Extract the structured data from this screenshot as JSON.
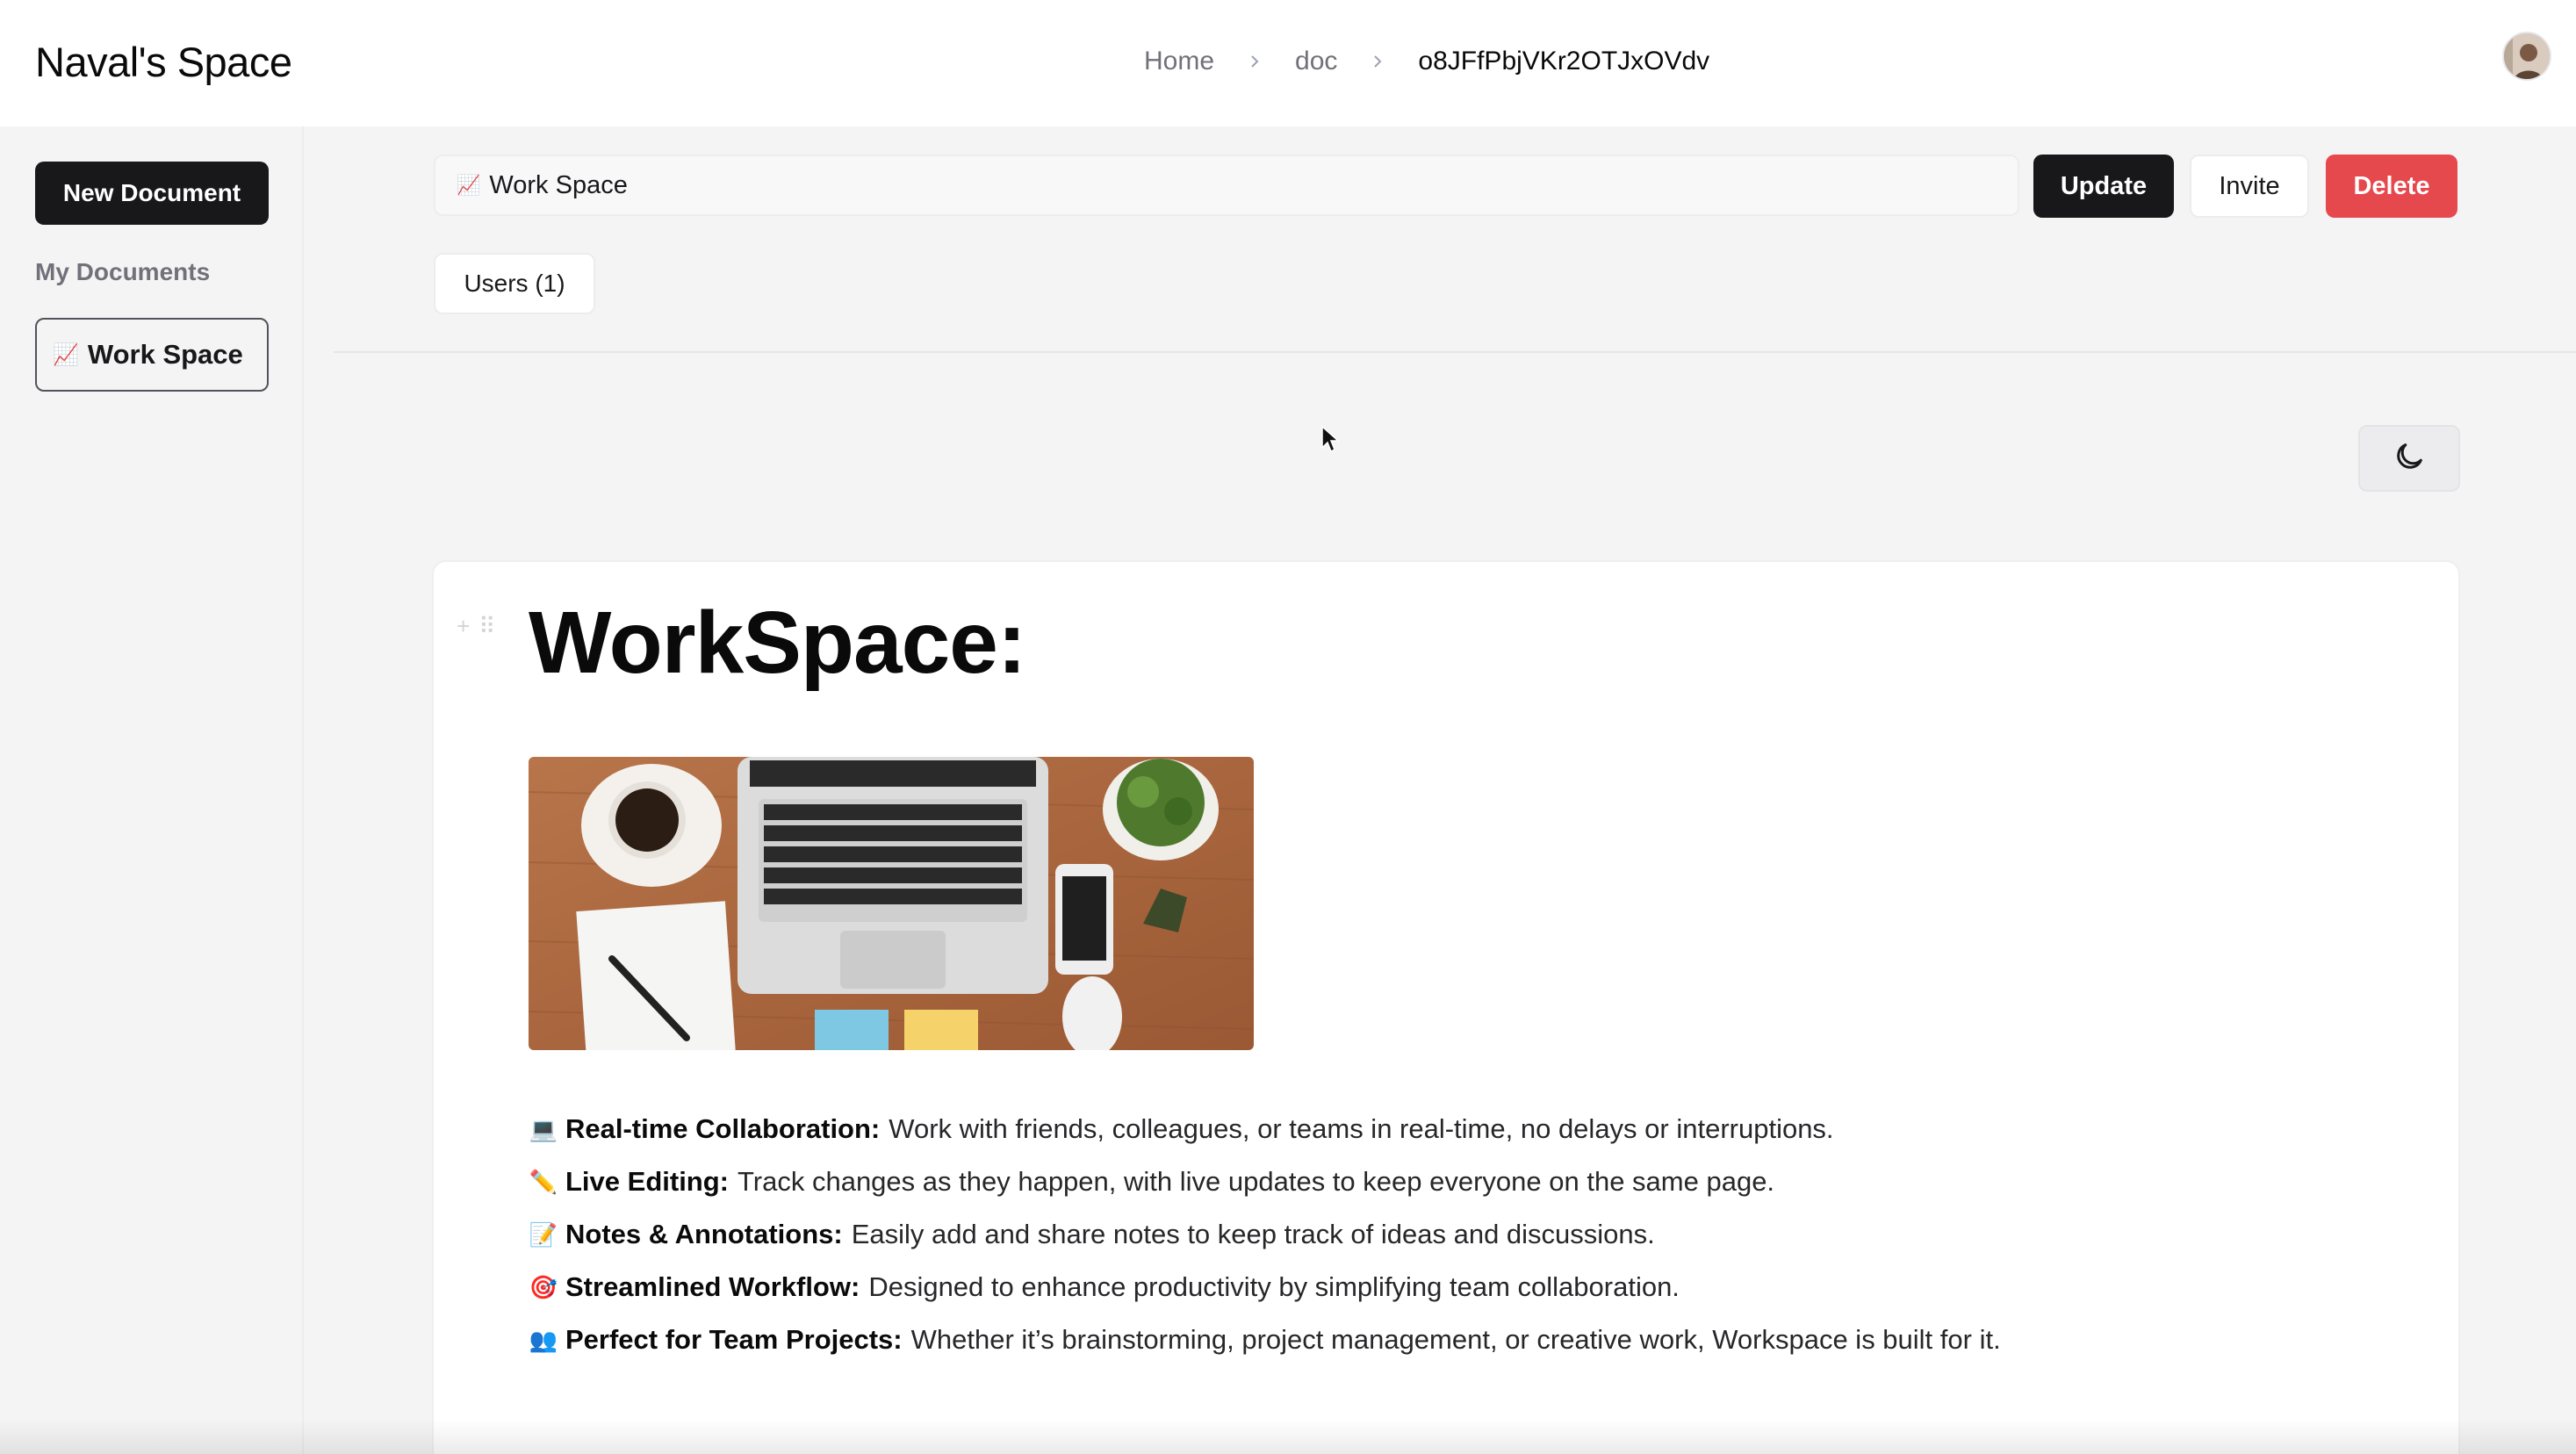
{
  "app": {
    "brand": "Naval's Space"
  },
  "breadcrumb": {
    "items": [
      "Home",
      "doc"
    ],
    "current": "o8JFfPbjVKr2OTJxOVdv"
  },
  "sidebar": {
    "new_document_label": "New Document",
    "section_label": "My Documents",
    "documents": [
      {
        "icon": "📈",
        "label": "Work Space"
      }
    ]
  },
  "toolbar": {
    "title_icon": "📈",
    "title_value": "Work Space",
    "update_label": "Update",
    "invite_label": "Invite",
    "delete_label": "Delete",
    "users_tab_label": "Users (1)"
  },
  "editor": {
    "heading": "WorkSpace:",
    "features": [
      {
        "icon": "💻",
        "label": "Real-time Collaboration:",
        "text": "Work with friends, colleagues, or teams in real-time, no delays or interruptions."
      },
      {
        "icon": "✏️",
        "label": "Live Editing:",
        "text": "Track changes as they happen, with live updates to keep everyone on the same page."
      },
      {
        "icon": "📝",
        "label": "Notes & Annotations:",
        "text": "Easily add and share notes to keep track of ideas and discussions."
      },
      {
        "icon": "🎯",
        "label": "Streamlined Workflow:",
        "text": "Designed to enhance productivity by simplifying team collaboration."
      },
      {
        "icon": "👥",
        "label": "Perfect for Team Projects:",
        "text": "Whether it’s brainstorming, project management, or creative work, Workspace is built for it."
      }
    ]
  },
  "icons": {
    "breadcrumb_separator": "chevron-right-icon",
    "theme_toggle": "moon-icon",
    "avatar": "user-avatar",
    "image": "workspace-desk-photo"
  },
  "colors": {
    "primary": "#18181b",
    "danger": "#e5484d",
    "background": "#f4f4f5",
    "surface": "#ffffff"
  }
}
